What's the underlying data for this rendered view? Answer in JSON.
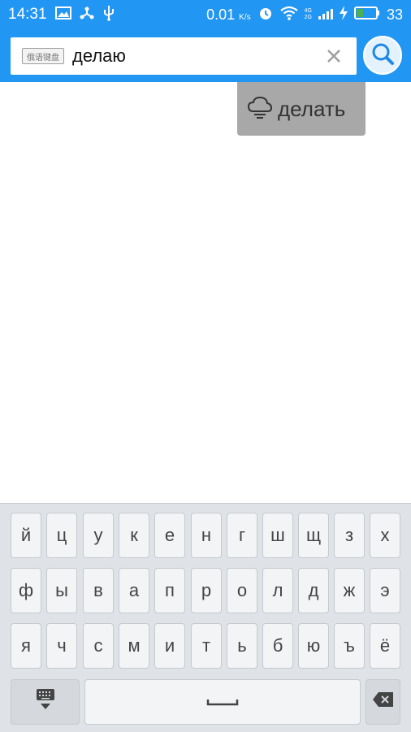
{
  "status_bar": {
    "time": "14:31",
    "net_speed": "0.01",
    "net_unit": "K/s",
    "battery": "33",
    "signal_4g": "4G",
    "signal_2g": "2G"
  },
  "search": {
    "keyboard_badge": "俄语键盘",
    "query": "делаю"
  },
  "suggestion": {
    "text": "делать"
  },
  "keyboard": {
    "row1": [
      "й",
      "ц",
      "у",
      "к",
      "е",
      "н",
      "г",
      "ш",
      "щ",
      "з",
      "х"
    ],
    "row2": [
      "ф",
      "ы",
      "в",
      "а",
      "п",
      "р",
      "о",
      "л",
      "д",
      "ж",
      "э"
    ],
    "row3": [
      "я",
      "ч",
      "с",
      "м",
      "и",
      "т",
      "ь",
      "б",
      "ю",
      "ъ",
      "ё"
    ]
  }
}
